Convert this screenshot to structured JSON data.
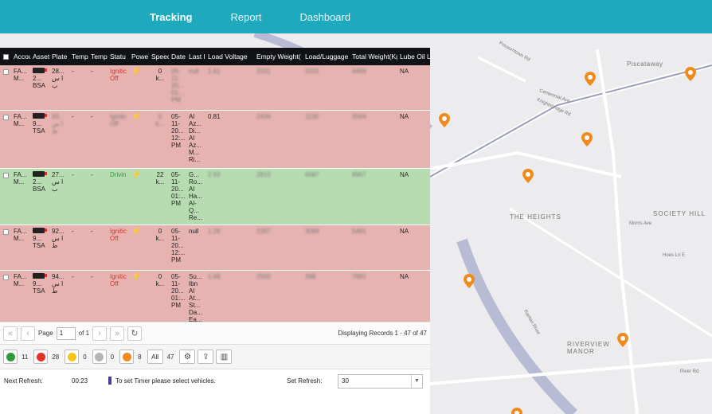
{
  "nav": {
    "tabs": [
      "Tracking",
      "Report",
      "Dashboard"
    ],
    "active": "Tracking"
  },
  "grid": {
    "columns": [
      "Accou",
      "Asset",
      "Plate",
      "Temp",
      "Temp",
      "Statu",
      "Powe",
      "Speed",
      "Date",
      "Last I",
      "Load Voltage",
      "Empty Weight(",
      "Load/Luggage",
      "Total Weight(Kg",
      "Lube Oil Le"
    ],
    "rows": [
      {
        "state": "stop",
        "account": "FA...\nM...",
        "asset": "2...\nBSA",
        "plate": "28...\nا س\nب",
        "temp1": "-",
        "temp2": "-",
        "status": "Ignitic\nOff",
        "speed": "0\nk...",
        "date": "05-\n11-\n20...\n01:...\nPM",
        "last": "null",
        "load_voltage": "1.61",
        "empty_weight": "2031",
        "luggage": "2031",
        "total_weight": "4469",
        "lube": "NA"
      },
      {
        "state": "stop",
        "account": "FA...\nM...",
        "asset": "9...\nTSA",
        "plate": "93...\nا س\nط",
        "temp1": "-",
        "temp2": "-",
        "status": "Ignitic\nOff",
        "speed": "0\nk...",
        "date": "05-\n11-\n20...\n12:...\nPM",
        "last": "Al\nAz...\nDi...\nAl\nAz...\nM...\nRi...",
        "load_voltage": "0.81",
        "empty_weight": "2434",
        "luggage": "1130",
        "total_weight": "3564",
        "lube": "NA"
      },
      {
        "state": "moving",
        "account": "FA...\nM...",
        "asset": "2...\nBSA",
        "plate": "27...\nا س\nب",
        "temp1": "-",
        "temp2": "-",
        "status": "Drivin",
        "speed": "22\nk...",
        "date": "05-\n11-\n20...\n01:...\nPM",
        "last": "G...\nRo...\nAl\nHa...\nAl-\nQ...\nRe...",
        "load_voltage": "2.93",
        "empty_weight": "2810",
        "luggage": "6087",
        "total_weight": "8967",
        "lube": "NA"
      },
      {
        "state": "stop",
        "account": "FA...\nM...",
        "asset": "9...\nTSA",
        "plate": "92...\nا س\nط",
        "temp1": "-",
        "temp2": "-",
        "status": "Ignitic\nOff",
        "speed": "0\nk...",
        "date": "05-\n11-\n20...\n12:...\nPM",
        "last": "null",
        "load_voltage": "1.26",
        "empty_weight": "2397",
        "luggage": "3094",
        "total_weight": "5491",
        "lube": "NA"
      },
      {
        "state": "stop",
        "account": "FA...\nM...",
        "asset": "9...\nTSA",
        "plate": "94...\nا س\nط",
        "temp1": "-",
        "temp2": "-",
        "status": "Ignitic\nOff",
        "speed": "0\nk...",
        "date": "05-\n11-\n20...\n01:...\nPM",
        "last": "Su...\nIbn\nAl\nAt...\nSt...\nDa...\nEa...",
        "load_voltage": "1.68",
        "empty_weight": "2500",
        "luggage": "398",
        "total_weight": "7691",
        "lube": "NA"
      }
    ]
  },
  "pager": {
    "page_label": "Page",
    "page_value": "1",
    "of_label": "of 1",
    "records": "Displaying Records 1 - 47 of 47"
  },
  "status_counts": [
    {
      "color": "#2f9a39",
      "count": "11"
    },
    {
      "color": "#e5312b",
      "count": "28"
    },
    {
      "color": "#f5c518",
      "count": "0"
    },
    {
      "color": "#b5b5b5",
      "count": "0"
    },
    {
      "color": "#f08a1c",
      "count": "8"
    }
  ],
  "all_label": "All",
  "all_count": "47",
  "refresh": {
    "next_label": "Next Refresh:",
    "timer": "00:23",
    "hint": "To set Timer please select vehicles.",
    "set_label": "Set Refresh:",
    "value": "30"
  },
  "map_labels": [
    "Piscataway",
    "THE HEIGHTS",
    "SOCIETY HILL",
    "RIVERVIEW\nMANOR",
    "Centennial Ave",
    "Hoes Ln E",
    "Morris Ave",
    "Raritan River",
    "Possumtown Rd",
    "Knightsbridge Rd",
    "River Rd"
  ],
  "colors": {
    "nav": "#1fa9bd",
    "stop_row": "#e7b3b0",
    "moving_row": "#b8dcb2",
    "pin": "#f08a1c"
  }
}
